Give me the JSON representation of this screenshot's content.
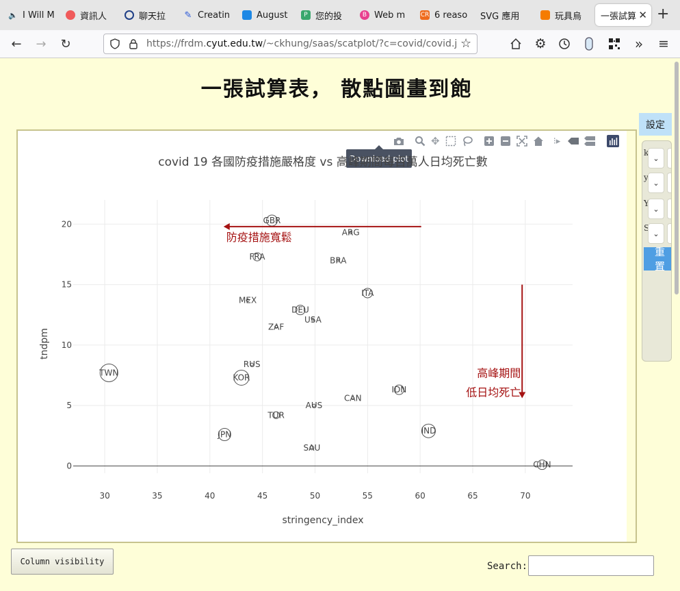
{
  "tabs": [
    {
      "label": "I Will M",
      "icon": "speaker-icon",
      "color": "#555555"
    },
    {
      "label": "資訊人",
      "icon": "app-icon",
      "color": "#f05a5a"
    },
    {
      "label": "聊天拉",
      "icon": "chat-icon",
      "color": "#1f3f86"
    },
    {
      "label": "Creatin",
      "icon": "edit-icon",
      "color": "#2a58d8"
    },
    {
      "label": "August",
      "icon": "calendar-icon",
      "color": "#1e88e5"
    },
    {
      "label": "您的投",
      "icon": "p-icon",
      "color": "#3aa76d"
    },
    {
      "label": "Web m",
      "icon": "b-icon",
      "color": "#e8408f"
    },
    {
      "label": "6 reaso",
      "icon": "cr-icon",
      "color": "#ef6c1e"
    },
    {
      "label": "SVG 應用",
      "icon": "",
      "color": ""
    },
    {
      "label": "玩具烏",
      "icon": "blogger-icon",
      "color": "#f57c00"
    },
    {
      "label": "一張試算",
      "icon": "",
      "color": ""
    }
  ],
  "url": {
    "prefix": "https://frdm.",
    "host": "cyut.edu.tw",
    "path": "/~ckhung/saas/scatplot/?c=covid/covid.json&s..."
  },
  "page": {
    "title": "一張試算表， 散點圖畫到飽",
    "settings_label": "設定",
    "reset_label": "重置",
    "colvis_label": "Column visibility",
    "search_label": "Search:"
  },
  "settings_letters": [
    "k",
    "y",
    "Y",
    "S"
  ],
  "modebar_tooltip": "Download plot",
  "chart_data": {
    "type": "scatter",
    "title": "covid 19 各國防疫措施嚴格度 vs 高峰期間每百萬人日均死亡數",
    "xlabel": "stringency_index",
    "ylabel": "tndpm",
    "xlim": [
      27,
      74.5
    ],
    "ylim": [
      -0.6,
      22
    ],
    "xticks": [
      30,
      35,
      40,
      45,
      50,
      55,
      60,
      65,
      70
    ],
    "yticks": [
      0,
      5,
      10,
      15,
      20
    ],
    "grid": true,
    "points": [
      {
        "label": "GBR",
        "x": 45.9,
        "y": 20.3,
        "size": 8
      },
      {
        "label": "ARG",
        "x": 53.4,
        "y": 19.3,
        "size": 2
      },
      {
        "label": "FRA",
        "x": 44.5,
        "y": 17.3,
        "size": 6
      },
      {
        "label": "BRA",
        "x": 52.2,
        "y": 17.0,
        "size": 2
      },
      {
        "label": "ITA",
        "x": 55.0,
        "y": 14.3,
        "size": 7
      },
      {
        "label": "MEX",
        "x": 43.6,
        "y": 13.7,
        "size": 2
      },
      {
        "label": "DEU",
        "x": 48.6,
        "y": 12.9,
        "size": 7
      },
      {
        "label": "USA",
        "x": 49.8,
        "y": 12.1,
        "size": 2
      },
      {
        "label": "ZAF",
        "x": 46.3,
        "y": 11.5,
        "size": 2
      },
      {
        "label": "RUS",
        "x": 44.0,
        "y": 8.4,
        "size": 2
      },
      {
        "label": "TWN",
        "x": 30.4,
        "y": 7.7,
        "size": 13
      },
      {
        "label": "KOR",
        "x": 43.0,
        "y": 7.3,
        "size": 11
      },
      {
        "label": "IDN",
        "x": 58.0,
        "y": 6.3,
        "size": 7
      },
      {
        "label": "CAN",
        "x": 53.6,
        "y": 5.6,
        "size": 2
      },
      {
        "label": "AUS",
        "x": 49.9,
        "y": 5.0,
        "size": 2
      },
      {
        "label": "TUR",
        "x": 46.3,
        "y": 4.2,
        "size": 5
      },
      {
        "label": "IND",
        "x": 60.8,
        "y": 2.9,
        "size": 10
      },
      {
        "label": "JPN",
        "x": 41.4,
        "y": 2.6,
        "size": 9
      },
      {
        "label": "SAU",
        "x": 49.7,
        "y": 1.5,
        "size": 3
      },
      {
        "label": "CHN",
        "x": 71.6,
        "y": 0.1,
        "size": 7
      }
    ],
    "annotations": [
      {
        "text": "防疫措施寬鬆",
        "x1": 60.1,
        "y1": 19.8,
        "x2": 41.3,
        "y2": 19.8
      },
      {
        "lines": [
          "高峰期間",
          "低日均死亡"
        ],
        "x1": 69.7,
        "y1": 15.0,
        "x2": 69.7,
        "y2": 5.6
      }
    ],
    "annotation_color": "#a51212"
  }
}
